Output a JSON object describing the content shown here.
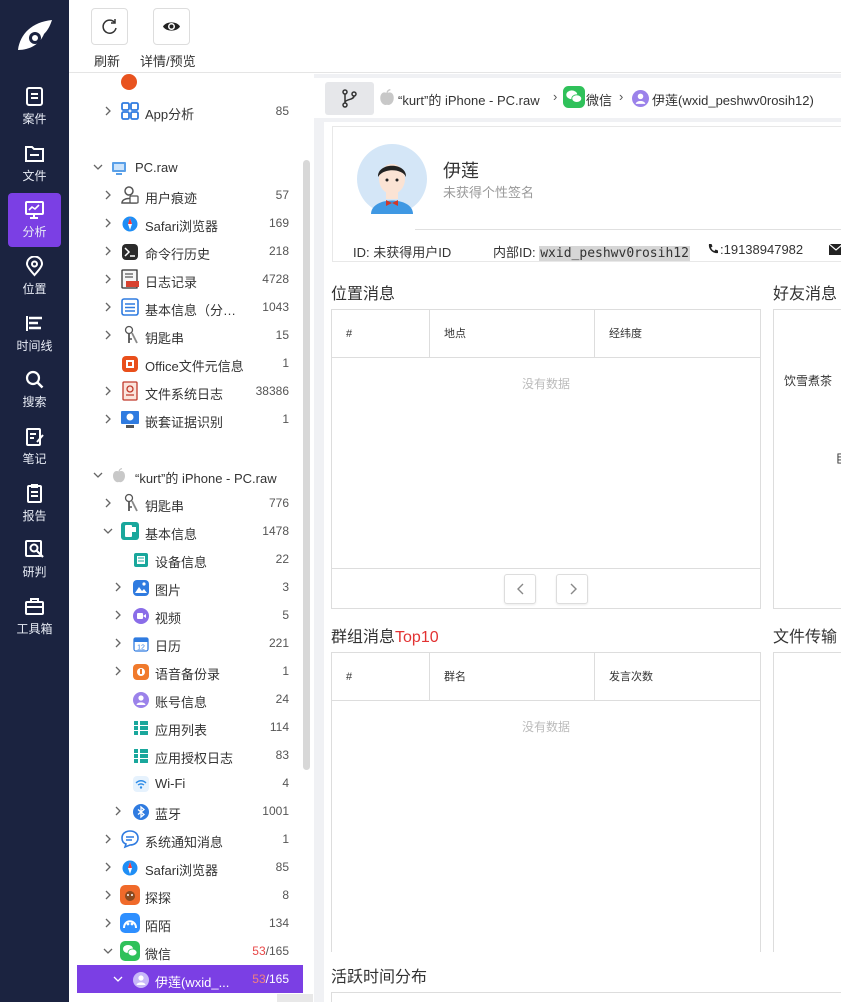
{
  "nav": {
    "items": [
      {
        "label": "案件",
        "icon": "case-icon"
      },
      {
        "label": "文件",
        "icon": "folder-icon"
      },
      {
        "label": "分析",
        "icon": "analysis-icon",
        "active": true
      },
      {
        "label": "位置",
        "icon": "location-icon"
      },
      {
        "label": "时间线",
        "icon": "timeline-icon"
      },
      {
        "label": "搜索",
        "icon": "search-icon"
      },
      {
        "label": "笔记",
        "icon": "note-icon"
      },
      {
        "label": "报告",
        "icon": "report-icon"
      },
      {
        "label": "研判",
        "icon": "research-icon"
      },
      {
        "label": "工具箱",
        "icon": "toolbox-icon"
      }
    ]
  },
  "toolbar": {
    "refresh_label": "刷新",
    "preview_label": "详情/预览"
  },
  "tree": {
    "app_analysis": {
      "label": "App分析",
      "count": "85"
    },
    "pc_root": {
      "label": "PC.raw"
    },
    "pc_items": [
      {
        "label": "用户痕迹",
        "count": "57"
      },
      {
        "label": "Safari浏览器",
        "count": "169"
      },
      {
        "label": "命令行历史",
        "count": "218"
      },
      {
        "label": "日志记录",
        "count": "4728"
      },
      {
        "label": "基本信息（分…",
        "count": "1043"
      },
      {
        "label": "钥匙串",
        "count": "15"
      },
      {
        "label": "Office文件元信息",
        "count": "1"
      },
      {
        "label": "文件系统日志",
        "count": "38386"
      },
      {
        "label": "嵌套证据识别",
        "count": "1"
      }
    ],
    "iphone_root": {
      "label": "“kurt”的 iPhone - PC.raw"
    },
    "iphone_items": [
      {
        "label": "钥匙串",
        "count": "776"
      },
      {
        "label": "基本信息",
        "count": "1478"
      }
    ],
    "basic_children": [
      {
        "label": "设备信息",
        "count": "22"
      },
      {
        "label": "图片",
        "count": "3"
      },
      {
        "label": "视频",
        "count": "5"
      },
      {
        "label": "日历",
        "count": "221"
      },
      {
        "label": "语音备份录",
        "count": "1"
      },
      {
        "label": "账号信息",
        "count": "24"
      },
      {
        "label": "应用列表",
        "count": "114"
      },
      {
        "label": "应用授权日志",
        "count": "83"
      },
      {
        "label": "Wi-Fi",
        "count": "4"
      },
      {
        "label": "蓝牙",
        "count": "1001"
      }
    ],
    "iphone_items_2": [
      {
        "label": "系统通知消息",
        "count": "1"
      },
      {
        "label": "Safari浏览器",
        "count": "85"
      },
      {
        "label": "探探",
        "count": "8"
      },
      {
        "label": "陌陌",
        "count": "134"
      }
    ],
    "wechat": {
      "label": "微信",
      "count_hl": "53",
      "count_total": "/165"
    },
    "selected": {
      "label": "伊莲(wxid_...",
      "count_hl": "53",
      "count_total": "/165"
    }
  },
  "breadcrumb": {
    "device": "“kurt”的 iPhone - PC.raw",
    "app": "微信",
    "account": "伊莲(wxid_peshwv0rosih12)"
  },
  "profile": {
    "name": "伊莲",
    "signature": "未获得个性签名",
    "id_label": "ID: 未获得用户ID",
    "internal_id_prefix": "内部ID: ",
    "internal_id": "wxid_peshwv0rosih12",
    "phone": ":19138947982"
  },
  "sections": {
    "location": {
      "title": "位置消息",
      "columns": [
        "#",
        "地点",
        "经纬度"
      ],
      "empty": "没有数据"
    },
    "friend": {
      "title": "好友消息",
      "visible_text": "饮雪煮茶",
      "visible_text_2": "臣"
    },
    "group": {
      "title": "群组消息",
      "title_hl": "Top10",
      "columns": [
        "#",
        "群名",
        "发言次数"
      ],
      "empty": "没有数据"
    },
    "file": {
      "title": "文件传输"
    },
    "activity": {
      "title": "活跃时间分布"
    }
  },
  "colors": {
    "nav_bg": "#1b2340",
    "accent": "#7b3fe4",
    "highlight_red": "#e23232"
  }
}
